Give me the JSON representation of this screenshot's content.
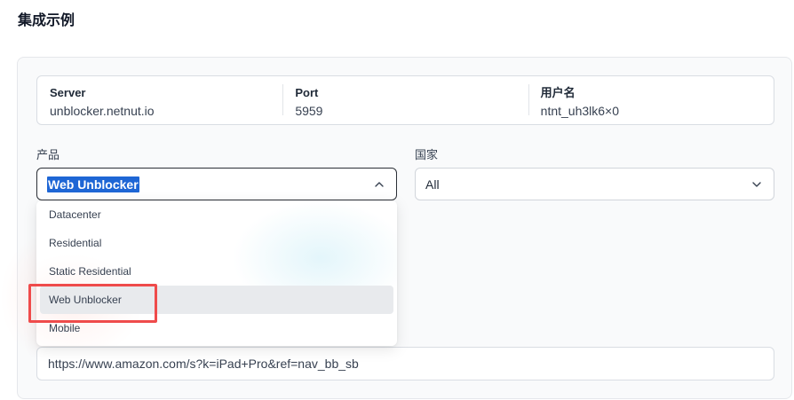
{
  "section": {
    "title": "集成示例"
  },
  "info": {
    "server_label": "Server",
    "server_value": "unblocker.netnut.io",
    "port_label": "Port",
    "port_value": "5959",
    "username_label": "用户名",
    "username_value": "ntnt_uh3lk6×0"
  },
  "product": {
    "label": "产品",
    "selected": "Web Unblocker",
    "options": [
      "Datacenter",
      "Residential",
      "Static Residential",
      "Web Unblocker",
      "Mobile"
    ]
  },
  "country": {
    "label": "国家",
    "selected": "All"
  },
  "url_input": {
    "value": "https://www.amazon.com/s?k=iPad+Pro&ref=nav_bb_sb"
  },
  "colors": {
    "highlight": "#1e66d5",
    "annotation_box": "#ef4b4b",
    "option_selected_bg": "#e8eaed"
  },
  "icons": {
    "product_chevron": "chevron-up-icon",
    "country_chevron": "chevron-down-icon"
  }
}
